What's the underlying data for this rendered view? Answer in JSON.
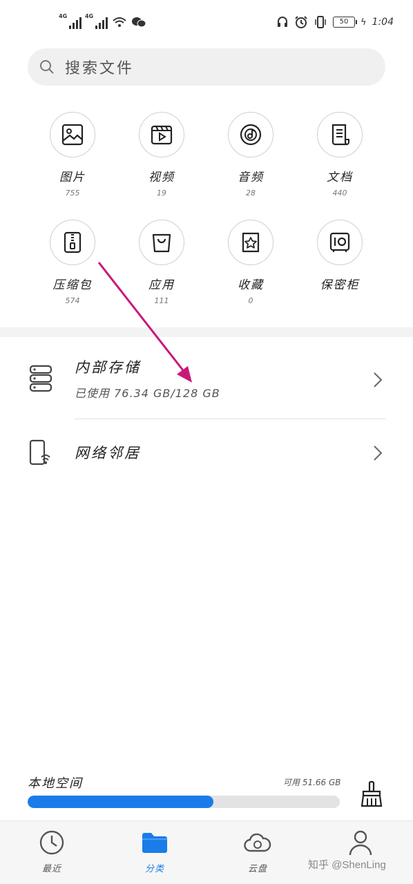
{
  "status_bar": {
    "network_1": "4G",
    "network_2": "4G",
    "battery": "50",
    "time": "1:04"
  },
  "search": {
    "placeholder": "搜索文件",
    "icon": "search-icon"
  },
  "categories": [
    {
      "label": "图片",
      "count": "755",
      "icon": "image-icon"
    },
    {
      "label": "视频",
      "count": "19",
      "icon": "video-icon"
    },
    {
      "label": "音频",
      "count": "28",
      "icon": "audio-icon"
    },
    {
      "label": "文档",
      "count": "440",
      "icon": "document-icon"
    },
    {
      "label": "压缩包",
      "count": "574",
      "icon": "zip-icon"
    },
    {
      "label": "应用",
      "count": "111",
      "icon": "app-bag-icon"
    },
    {
      "label": "收藏",
      "count": "0",
      "icon": "star-icon"
    },
    {
      "label": "保密柜",
      "count": "",
      "icon": "safe-icon"
    }
  ],
  "storage": {
    "internal_title": "内部存储",
    "internal_usage": "已使用 76.34 GB/128 GB",
    "network_title": "网络邻居"
  },
  "local_space": {
    "label": "本地空间",
    "available": "可用 51.66 GB",
    "used_fraction": 0.596
  },
  "bottom_nav": {
    "items": [
      {
        "label": "最近",
        "icon": "clock-icon",
        "active": false
      },
      {
        "label": "分类",
        "icon": "folder-icon",
        "active": true
      },
      {
        "label": "云盘",
        "icon": "cloud-icon",
        "active": false
      },
      {
        "label": "我的",
        "icon": "person-icon",
        "active": false
      }
    ]
  },
  "watermark": "知乎 @ShenLing",
  "colors": {
    "accent": "#1a7ce8",
    "annotation_arrow": "#c8197a"
  }
}
